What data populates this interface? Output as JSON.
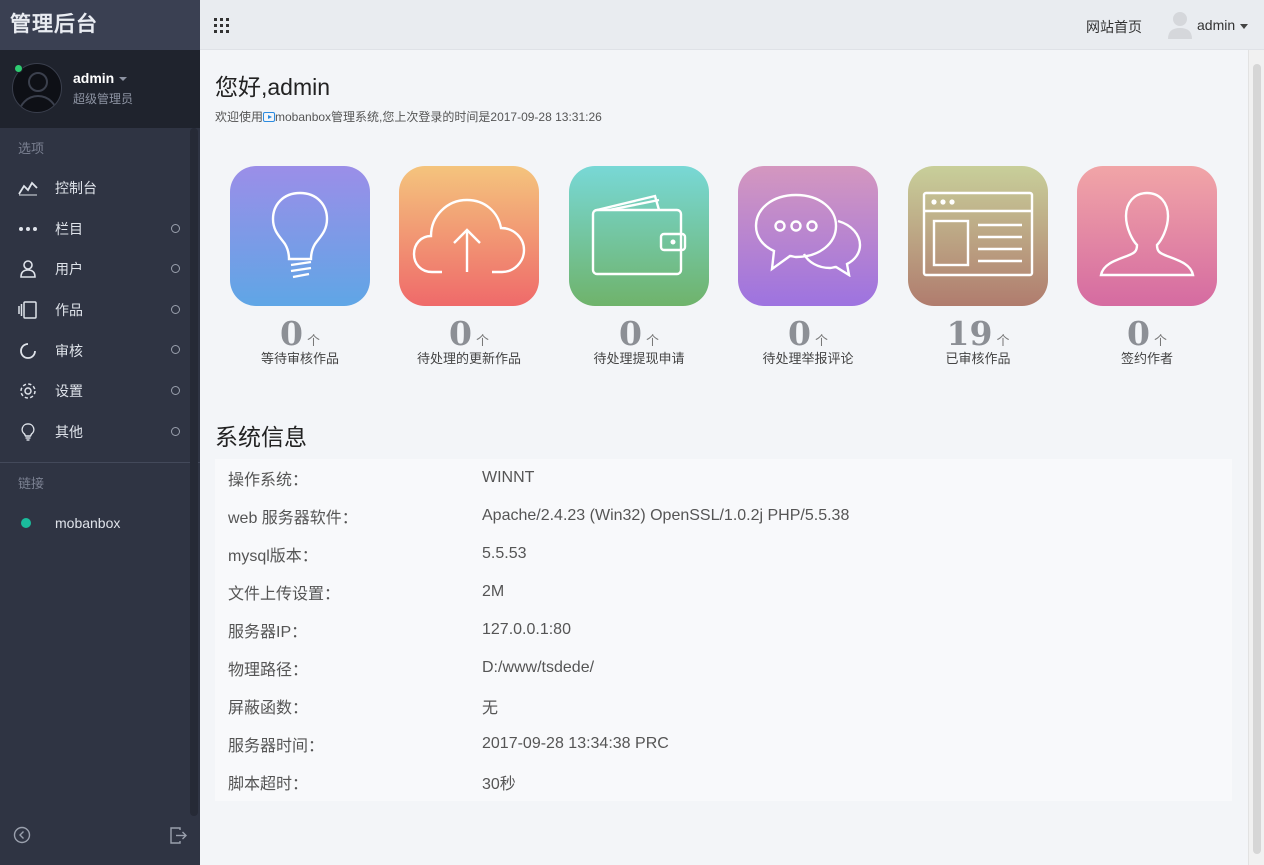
{
  "sidebar": {
    "brand": "管理后台",
    "user": {
      "name": "admin",
      "role": "超级管理员"
    },
    "section_options": "选项",
    "items": [
      {
        "label": "控制台",
        "icon": "trend-icon"
      },
      {
        "label": "栏目",
        "icon": "ellipsis-icon"
      },
      {
        "label": "用户",
        "icon": "user-icon"
      },
      {
        "label": "作品",
        "icon": "tablet-icon"
      },
      {
        "label": "审核",
        "icon": "loading-icon"
      },
      {
        "label": "设置",
        "icon": "gear-icon"
      },
      {
        "label": "其他",
        "icon": "bulb-icon"
      }
    ],
    "section_links": "链接",
    "links": [
      {
        "label": "mobanbox"
      }
    ]
  },
  "header": {
    "home_link": "网站首页",
    "user": "admin"
  },
  "main": {
    "greeting": "您好,admin",
    "welcome_prefix": "欢迎使用",
    "welcome_suffix": "mobanbox管理系统,您上次登录的时间是2017-09-28 13:31:26",
    "tiles": [
      {
        "count": "0",
        "unit": "个",
        "label": "等待审核作品",
        "icon": "bulb-icon",
        "color_top": "#9b8ee8",
        "color_bottom": "#5fa6e6"
      },
      {
        "count": "0",
        "unit": "个",
        "label": "待处理的更新作品",
        "icon": "cloud-upload-icon",
        "color_top": "#f4c47d",
        "color_bottom": "#ef6a6a"
      },
      {
        "count": "0",
        "unit": "个",
        "label": "待处理提现申请",
        "icon": "wallet-icon",
        "color_top": "#78d8d6",
        "color_bottom": "#6fb36b"
      },
      {
        "count": "0",
        "unit": "个",
        "label": "待处理举报评论",
        "icon": "chat-icon",
        "color_top": "#d497bf",
        "color_bottom": "#9d73e0"
      },
      {
        "count": "19",
        "unit": "个",
        "label": "已审核作品",
        "icon": "browser-window-icon",
        "color_top": "#c8cf9a",
        "color_bottom": "#b07c6e"
      },
      {
        "count": "0",
        "unit": "个",
        "label": "签约作者",
        "icon": "person-icon",
        "color_top": "#f1a5a7",
        "color_bottom": "#d56ba1"
      }
    ],
    "system_title": "系统信息",
    "system_rows": [
      {
        "key": "操作系统：",
        "value": "WINNT"
      },
      {
        "key": "web 服务器软件：",
        "value": "Apache/2.4.23 (Win32) OpenSSL/1.0.2j PHP/5.5.38"
      },
      {
        "key": "mysql版本：",
        "value": "5.5.53"
      },
      {
        "key": "文件上传设置：",
        "value": "2M"
      },
      {
        "key": "服务器IP：",
        "value": "127.0.0.1:80"
      },
      {
        "key": "物理路径：",
        "value": "D:/www/tsdede/"
      },
      {
        "key": "屏蔽函数：",
        "value": "无"
      },
      {
        "key": "服务器时间：",
        "value": "2017-09-28 13:34:38 PRC"
      },
      {
        "key": "脚本超时：",
        "value": "30秒"
      }
    ]
  }
}
